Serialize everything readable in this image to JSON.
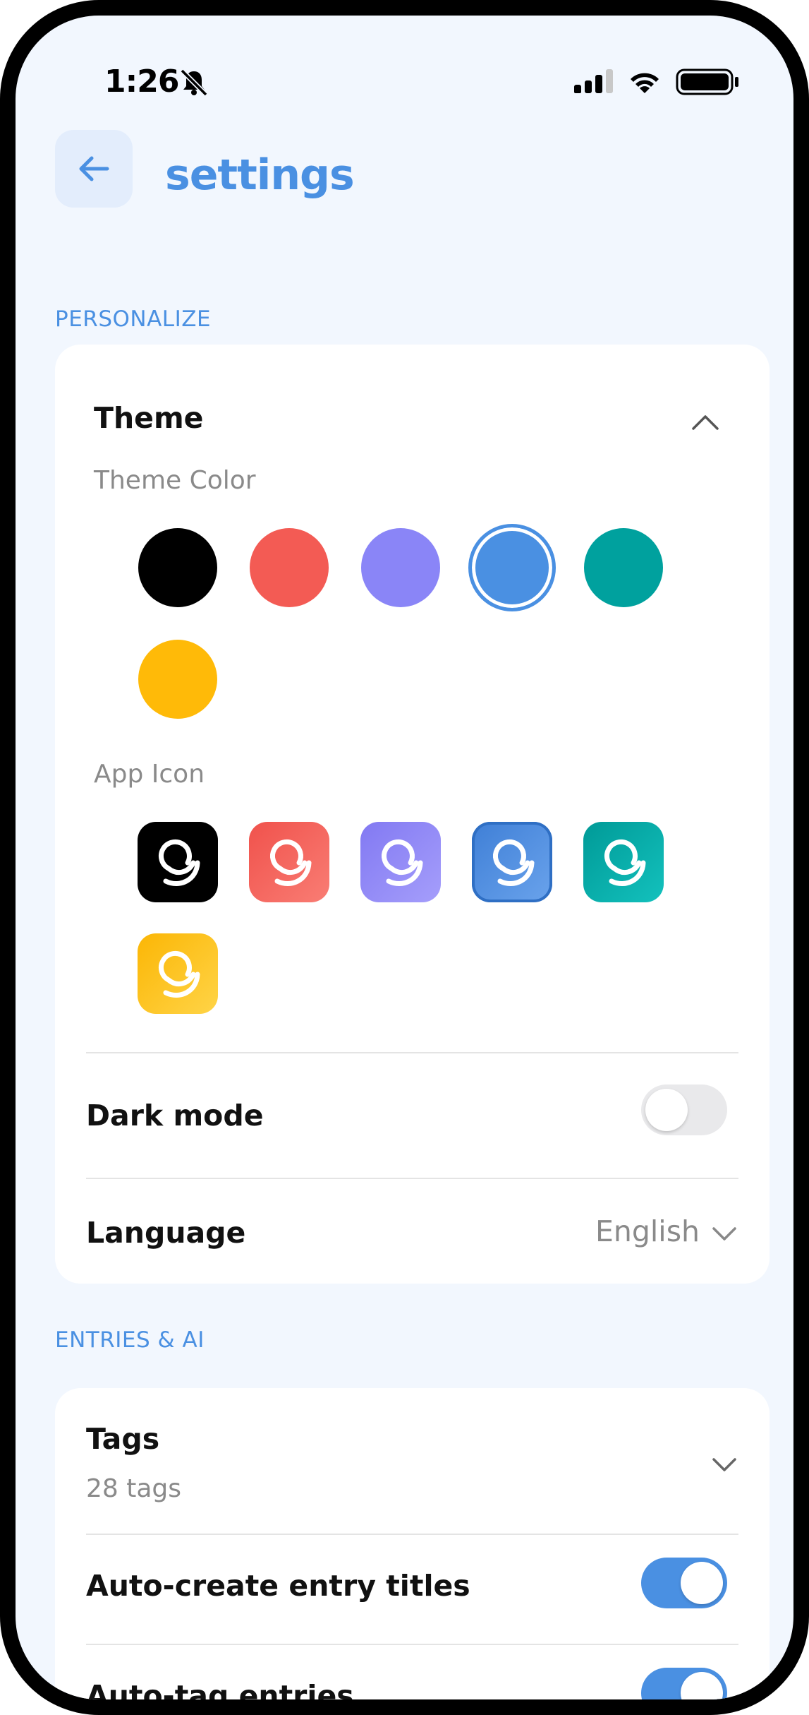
{
  "status_bar": {
    "time": "1:26"
  },
  "header": {
    "title": "settings"
  },
  "sections": {
    "personalize": "PERSONALIZE",
    "entries_ai": "ENTRIES & AI"
  },
  "theme": {
    "title": "Theme",
    "color_label": "Theme Color",
    "icon_label": "App Icon",
    "colors": [
      "#000000",
      "#F35B54",
      "#8A85F7",
      "#4A90E2",
      "#00A19E",
      "#FFBA08"
    ],
    "selected_color": "#4A90E2"
  },
  "dark_mode": {
    "label": "Dark mode",
    "enabled": false
  },
  "language": {
    "label": "Language",
    "value": "English"
  },
  "tags": {
    "label": "Tags",
    "count_text": "28 tags"
  },
  "auto_titles": {
    "label": "Auto-create entry titles",
    "enabled": true
  },
  "auto_tag": {
    "label": "Auto-tag entries",
    "enabled": true
  }
}
